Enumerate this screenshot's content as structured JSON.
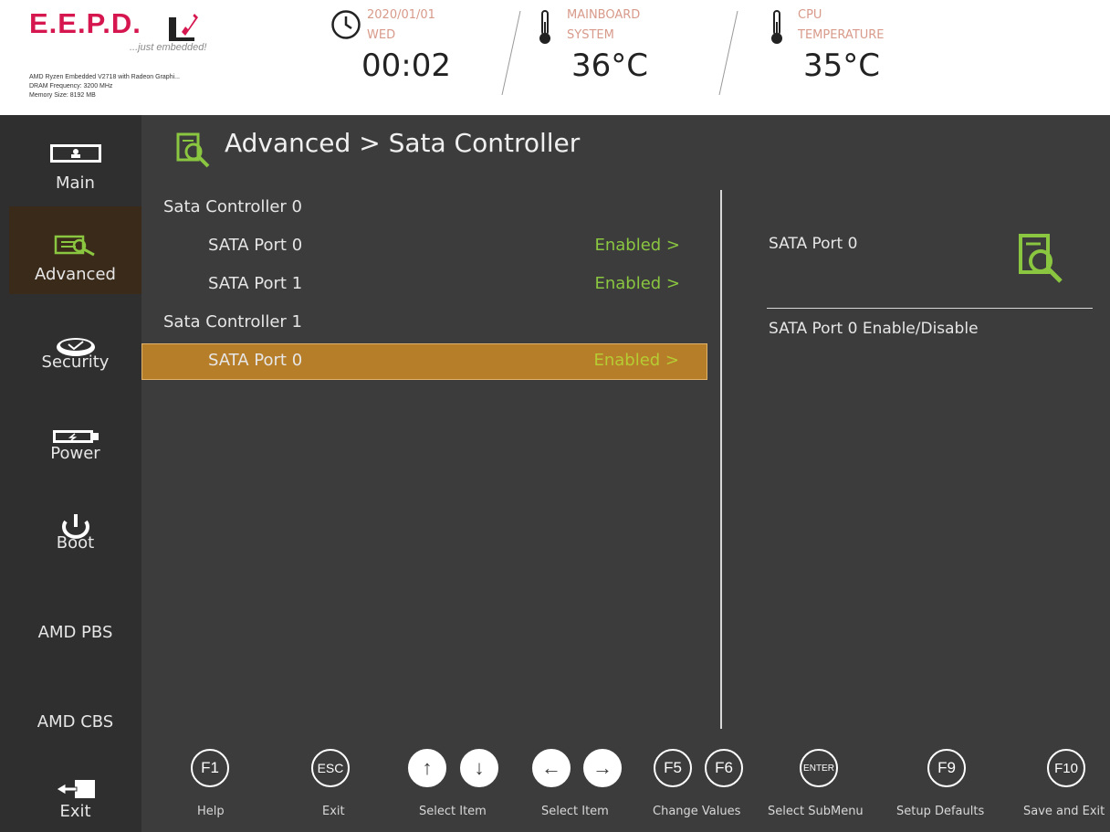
{
  "brand": {
    "title": "E.E.P.D.",
    "tagline": "...just embedded!",
    "cpu_line": "AMD Ryzen Embedded V2718 with Radeon Graphi...",
    "dram_line": "DRAM Frequency: 3200 MHz",
    "memory_line": "Memory Size: 8192 MB"
  },
  "clock": {
    "date": "2020/01/01",
    "day": "WED",
    "time": "00:02",
    "icon": "clock-icon"
  },
  "mainboard": {
    "line1": "MAINBOARD",
    "line2": "SYSTEM",
    "temp": "36°C",
    "icon": "thermometer-icon"
  },
  "cpu_temp": {
    "line1": "CPU",
    "line2": "TEMPERATURE",
    "temp": "35°C",
    "icon": "thermometer-icon"
  },
  "sidebar": [
    {
      "label": "Main",
      "icon": "monitor-icon"
    },
    {
      "label": "Advanced",
      "icon": "advanced-icon",
      "active": true
    },
    {
      "label": "Security",
      "icon": "shield-icon"
    },
    {
      "label": "Power",
      "icon": "battery-icon"
    },
    {
      "label": "Boot",
      "icon": "power-icon"
    },
    {
      "label": "AMD PBS"
    },
    {
      "label": "AMD CBS"
    },
    {
      "label": "Exit",
      "icon": "exit-icon"
    }
  ],
  "title": "Advanced > Sata Controller",
  "rows": [
    {
      "label": "Sata Controller 0",
      "value": ""
    },
    {
      "label": "SATA Port 0",
      "value": "Enabled >"
    },
    {
      "label": "SATA Port 1",
      "value": "Enabled >"
    },
    {
      "label": "Sata Controller 1",
      "value": ""
    },
    {
      "label": "SATA Port 0",
      "value": "Enabled >",
      "selected": true
    }
  ],
  "help": {
    "title": "SATA Port 0",
    "description": "SATA Port 0 Enable/Disable"
  },
  "footer": [
    {
      "keys": [
        "F1"
      ],
      "label": "Help"
    },
    {
      "keys": [
        "ESC"
      ],
      "label": "Exit"
    },
    {
      "keys": [
        "↑",
        "↓"
      ],
      "label": "Select Item"
    },
    {
      "keys": [
        "←",
        "→"
      ],
      "label": "Select Item"
    },
    {
      "keys": [
        "F5",
        "F6"
      ],
      "label": "Change Values"
    },
    {
      "keys": [
        "ENTER"
      ],
      "label": "Select  SubMenu"
    },
    {
      "keys": [
        "F9"
      ],
      "label": "Setup Defaults"
    },
    {
      "keys": [
        "F10"
      ],
      "label": "Save and Exit"
    }
  ],
  "colors": {
    "accent_green": "#8ac640",
    "selection": "#b77e2a",
    "brand": "#d6174f"
  }
}
